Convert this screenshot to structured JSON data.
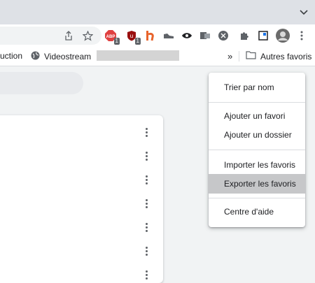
{
  "toolbar": {
    "extensions": [
      {
        "icon": "adblock-icon",
        "label": "ABP",
        "badge": "1",
        "color": "#e04040"
      },
      {
        "icon": "ublock-icon",
        "label": "u",
        "badge": "1",
        "color": "#9a0f0f"
      },
      {
        "icon": "honey-icon",
        "label": "h",
        "badge": "",
        "color": "#e8642c"
      },
      {
        "icon": "shoe-icon",
        "label": "",
        "badge": "",
        "color": "#5f6368"
      },
      {
        "icon": "eye-icon",
        "label": "",
        "badge": "",
        "color": "#202124"
      },
      {
        "icon": "office-icon",
        "label": "",
        "badge": "",
        "color": "#5f6368"
      },
      {
        "icon": "vpn-icon",
        "label": "",
        "badge": "",
        "color": "#5f6368"
      }
    ]
  },
  "bookmarks_bar": {
    "items": [
      {
        "label": "uction"
      },
      {
        "label": "Videostream"
      }
    ],
    "overflow": "»",
    "other_folder": "Autres favoris"
  },
  "menu": {
    "items": [
      {
        "label": "Trier par nom"
      },
      {
        "label": "Ajouter un favori"
      },
      {
        "label": "Ajouter un dossier"
      },
      {
        "label": "Importer les favoris"
      },
      {
        "label": "Exporter les favoris"
      },
      {
        "label": "Centre d'aide"
      }
    ],
    "highlighted_index": 4
  },
  "colors": {
    "menu_highlight": "#c6c7c9",
    "page_background": "#f1f3f4"
  }
}
